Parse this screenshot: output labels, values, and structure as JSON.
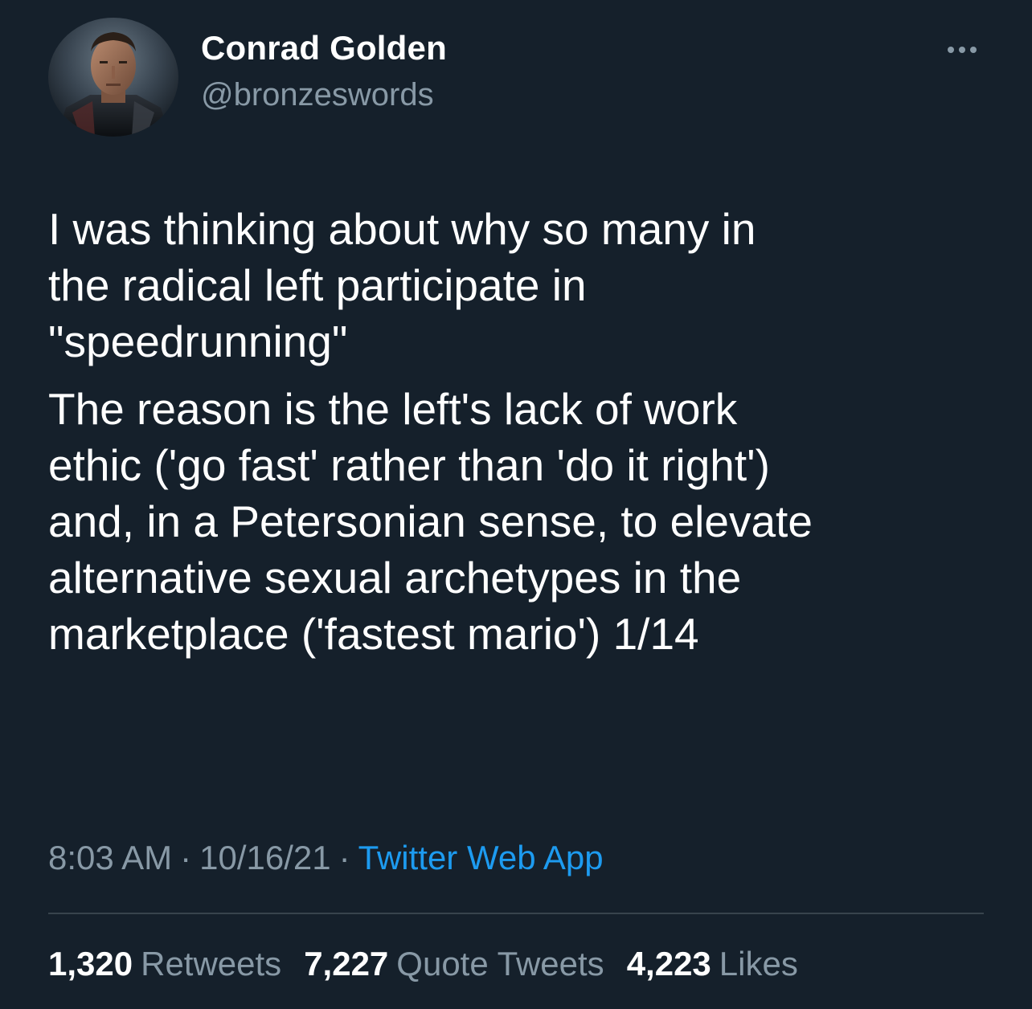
{
  "user": {
    "display_name": "Conrad Golden",
    "handle": "@bronzeswords"
  },
  "tweet": {
    "paragraphs": [
      "I was thinking about why so many in\nthe radical left participate in\n\"speedrunning\"",
      "The reason is the left's lack of work\nethic ('go fast' rather than 'do it right')\nand, in a Petersonian sense, to elevate\nalternative sexual archetypes in the\nmarketplace ('fastest mario') 1/14"
    ],
    "time": "8:03 AM",
    "date": "10/16/21",
    "separator": "·",
    "source": "Twitter Web App"
  },
  "stats": {
    "retweets_count": "1,320",
    "retweets_label": "Retweets",
    "quotes_count": "7,227",
    "quotes_label": "Quote Tweets",
    "likes_count": "4,223",
    "likes_label": "Likes"
  },
  "colors": {
    "background": "#15202b",
    "text_primary": "#ffffff",
    "text_secondary": "#8899a6",
    "link": "#1d9bf0",
    "divider": "#38444d"
  },
  "icons": {
    "more": "more-horizontal-icon"
  }
}
